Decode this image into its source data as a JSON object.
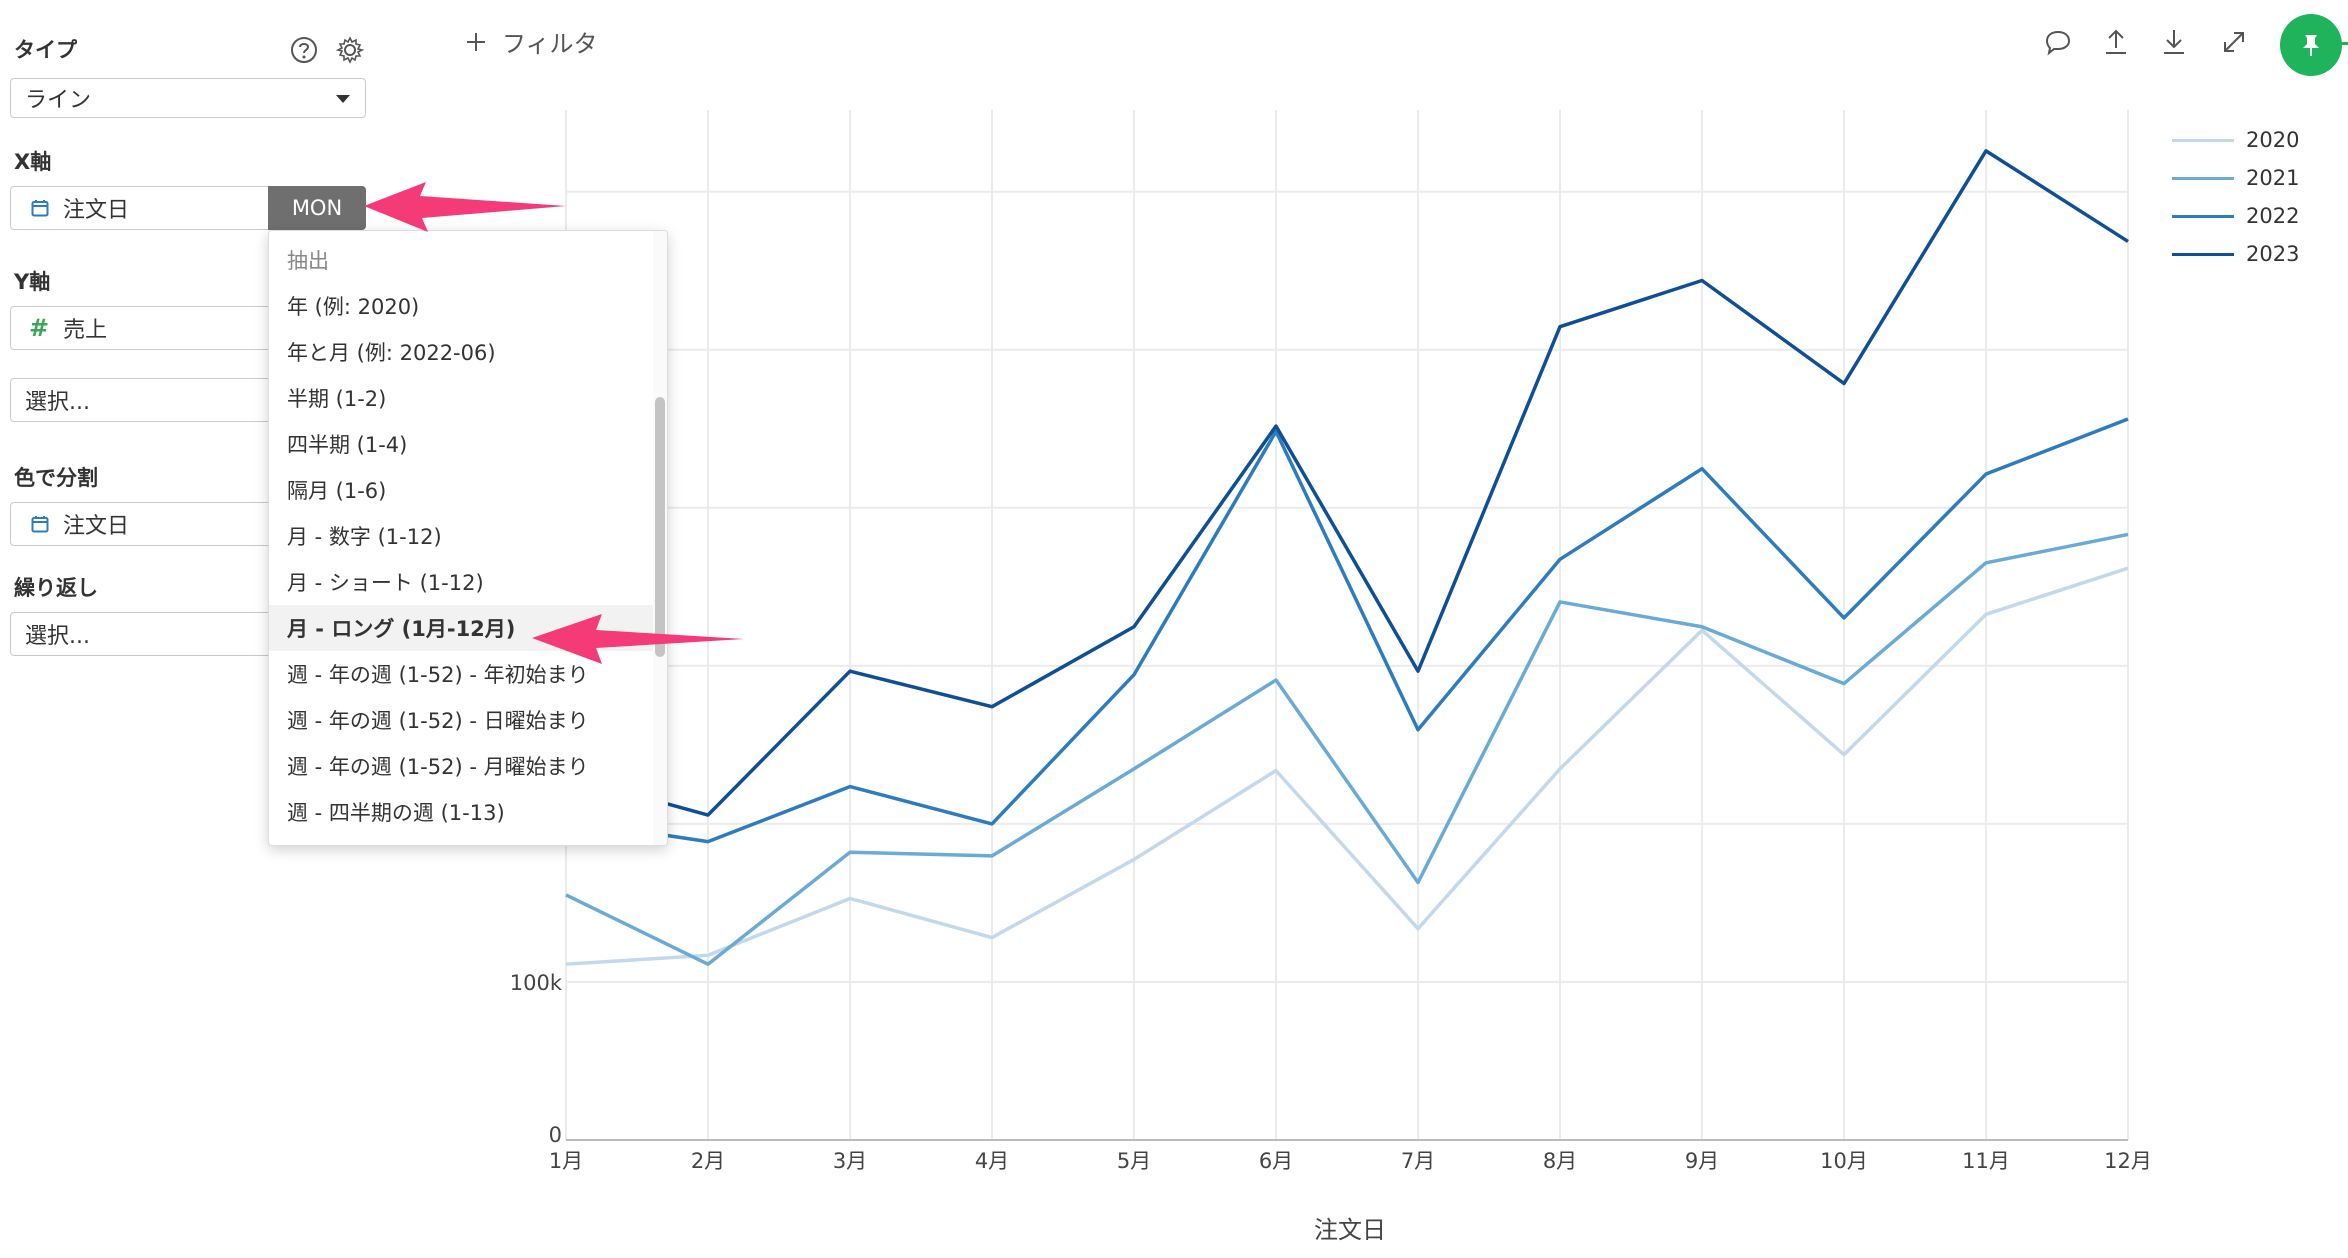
{
  "sidebar": {
    "type_label": "タイプ",
    "type_value": "ライン",
    "x_axis_label": "X軸",
    "x_axis_field": "注文日",
    "x_axis_agg": "MON",
    "y_axis_label": "Y軸",
    "y_axis_field": "売上",
    "y_axis_select_placeholder": "選択...",
    "color_label": "色で分割",
    "color_field": "注文日",
    "repeat_label": "繰り返し",
    "repeat_placeholder": "選択..."
  },
  "dropdown": {
    "items": [
      {
        "label": "抽出",
        "kind": "header"
      },
      {
        "label": "年 (例: 2020)"
      },
      {
        "label": "年と月 (例: 2022-06)"
      },
      {
        "label": "半期 (1-2)"
      },
      {
        "label": "四半期 (1-4)"
      },
      {
        "label": "隔月 (1-6)"
      },
      {
        "label": "月 - 数字 (1-12)"
      },
      {
        "label": "月 - ショート (1-12)"
      },
      {
        "label": "月 - ロング (1月-12月)",
        "selected": true
      },
      {
        "label": "週 - 年の週 (1-52) - 年初始まり"
      },
      {
        "label": "週 - 年の週 (1-52) - 日曜始まり"
      },
      {
        "label": "週 - 年の週 (1-52) - 月曜始まり"
      },
      {
        "label": "週 - 四半期の週 (1-13)"
      }
    ]
  },
  "toolbar": {
    "filter_label": "フィルタ",
    "icons": [
      "comment-icon",
      "upload-icon",
      "download-icon",
      "expand-icon",
      "pin-icon"
    ]
  },
  "colors": {
    "s2020": "#c2d8ec",
    "s2021": "#6aaad6",
    "s2022": "#2d7cbf",
    "s2023": "#0f4f96",
    "accent": "#1fb45c",
    "annotation_arrow": "#f43a77"
  },
  "chart_data": {
    "type": "line",
    "categories": [
      "1月",
      "2月",
      "3月",
      "4月",
      "5月",
      "6月",
      "7月",
      "8月",
      "9月",
      "10月",
      "11月",
      "12月"
    ],
    "xlabel": "注文日",
    "ylabel": "",
    "ytick_labels": [
      "0",
      "100k"
    ],
    "ylim": [
      0,
      580000
    ],
    "grid": true,
    "legend_position": "top-right",
    "series": [
      {
        "name": "2020",
        "values": [
          99000,
          104000,
          136000,
          114000,
          158000,
          208000,
          119000,
          209000,
          287000,
          217000,
          296000,
          322000
        ]
      },
      {
        "name": "2021",
        "values": [
          138000,
          99000,
          162000,
          160000,
          209000,
          259000,
          145000,
          303000,
          289000,
          257000,
          325000,
          341000
        ]
      },
      {
        "name": "2022",
        "values": [
          180000,
          168000,
          199000,
          178000,
          262000,
          399000,
          231000,
          327000,
          378000,
          294000,
          375000,
          406000
        ]
      },
      {
        "name": "2023",
        "values": [
          205000,
          183000,
          264000,
          244000,
          289000,
          402000,
          264000,
          458000,
          484000,
          426000,
          557000,
          506000
        ]
      }
    ]
  }
}
